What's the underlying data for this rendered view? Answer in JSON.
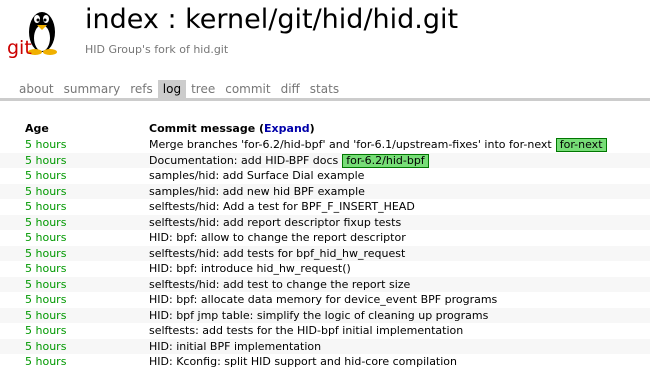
{
  "header": {
    "title": "index : kernel/git/hid/hid.git",
    "subtitle": "HID Group's fork of hid.git",
    "logo_icon": "git-tux-logo"
  },
  "tabs": [
    {
      "label": "about",
      "active": false
    },
    {
      "label": "summary",
      "active": false
    },
    {
      "label": "refs",
      "active": false
    },
    {
      "label": "log",
      "active": true
    },
    {
      "label": "tree",
      "active": false
    },
    {
      "label": "commit",
      "active": false
    },
    {
      "label": "diff",
      "active": false
    },
    {
      "label": "stats",
      "active": false
    }
  ],
  "log": {
    "age_header": "Age",
    "message_header": "Commit message",
    "expand_label": "Expand",
    "rows": [
      {
        "age": "5 hours",
        "message": "Merge branches 'for-6.2/hid-bpf' and 'for-6.1/upstream-fixes' into for-next",
        "badge": "for-next"
      },
      {
        "age": "5 hours",
        "message": "Documentation: add HID-BPF docs",
        "badge": "for-6.2/hid-bpf"
      },
      {
        "age": "5 hours",
        "message": "samples/hid: add Surface Dial example",
        "badge": ""
      },
      {
        "age": "5 hours",
        "message": "samples/hid: add new hid BPF example",
        "badge": ""
      },
      {
        "age": "5 hours",
        "message": "selftests/hid: Add a test for BPF_F_INSERT_HEAD",
        "badge": ""
      },
      {
        "age": "5 hours",
        "message": "selftests/hid: add report descriptor fixup tests",
        "badge": ""
      },
      {
        "age": "5 hours",
        "message": "HID: bpf: allow to change the report descriptor",
        "badge": ""
      },
      {
        "age": "5 hours",
        "message": "selftests/hid: add tests for bpf_hid_hw_request",
        "badge": ""
      },
      {
        "age": "5 hours",
        "message": "HID: bpf: introduce hid_hw_request()",
        "badge": ""
      },
      {
        "age": "5 hours",
        "message": "selftests/hid: add test to change the report size",
        "badge": ""
      },
      {
        "age": "5 hours",
        "message": "HID: bpf: allocate data memory for device_event BPF programs",
        "badge": ""
      },
      {
        "age": "5 hours",
        "message": "HID: bpf jmp table: simplify the logic of cleaning up programs",
        "badge": ""
      },
      {
        "age": "5 hours",
        "message": "selftests: add tests for the HID-bpf initial implementation",
        "badge": ""
      },
      {
        "age": "5 hours",
        "message": "HID: initial BPF implementation",
        "badge": ""
      },
      {
        "age": "5 hours",
        "message": "HID: Kconfig: split HID support and hid-core compilation",
        "badge": ""
      }
    ]
  },
  "colors": {
    "age": "#009900",
    "link": "#0000aa",
    "badge_bg": "#77dd77",
    "badge_border": "#007700",
    "tab_active_bg": "#cccccc"
  }
}
